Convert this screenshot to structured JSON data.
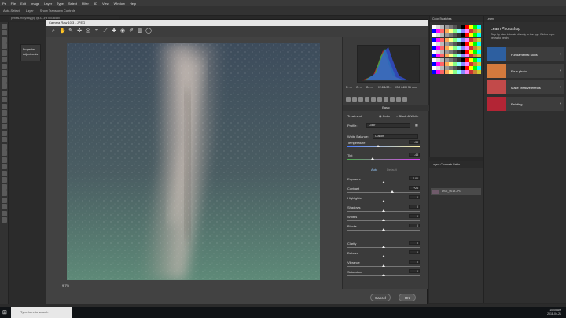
{
  "menubar": [
    "Ps",
    "File",
    "Edit",
    "Image",
    "Layer",
    "Type",
    "Select",
    "Filter",
    "3D",
    "View",
    "Window",
    "Help"
  ],
  "options": [
    "Auto-Select",
    "Layer",
    "Show Transform Controls"
  ],
  "doc_tab": "pexels-milkyway.jpg @ 33.3% (RGB/8#)",
  "dialog": {
    "title": "Camera Raw 10.3 - JPEG",
    "zoom": "9.7%",
    "cancel": "Cancel",
    "ok": "OK"
  },
  "props": {
    "properties": "Properties",
    "adjustments": "Adjustments"
  },
  "rgb": {
    "r": "R: ---",
    "g": "G: ---",
    "b": "B: ---",
    "f": "f/2.8  1/80 s",
    "iso": "ISO 6400  35 mm"
  },
  "panel": {
    "section": "Basic",
    "treatment": "Treatment:",
    "color": "Color",
    "bw": "Black & White",
    "profile": "Profile:",
    "profile_val": "Color",
    "wb": "White Balance:",
    "wb_val": "Custom",
    "auto": "Auto",
    "default": "Default",
    "sliders": [
      {
        "label": "Temperature",
        "value": "-33",
        "pos": 0.42
      },
      {
        "label": "Tint",
        "value": "-43",
        "pos": 0.35
      },
      {
        "label": "Exposure",
        "value": "0.00",
        "pos": 0.5
      },
      {
        "label": "Contrast",
        "value": "+24",
        "pos": 0.62
      },
      {
        "label": "Highlights",
        "value": "0",
        "pos": 0.5
      },
      {
        "label": "Shadows",
        "value": "0",
        "pos": 0.5
      },
      {
        "label": "Whites",
        "value": "0",
        "pos": 0.5
      },
      {
        "label": "Blacks",
        "value": "0",
        "pos": 0.5
      },
      {
        "label": "Clarity",
        "value": "0",
        "pos": 0.5
      },
      {
        "label": "Dehaze",
        "value": "0",
        "pos": 0.5
      },
      {
        "label": "Vibrance",
        "value": "0",
        "pos": 0.5
      },
      {
        "label": "Saturation",
        "value": "0",
        "pos": 0.5
      }
    ]
  },
  "swatches": {
    "tabs": "Color   Swatches"
  },
  "layers": {
    "tabs": "Layers   Channels   Paths",
    "layer": "DSC_0019.JPG"
  },
  "learn": {
    "head": "Learn",
    "title": "Learn Photoshop",
    "sub": "Step-by-step tutorials directly in the app. Pick a topic below to begin.",
    "cards": [
      "Fundamental Skills",
      "Fix a photo",
      "Make creative effects",
      "Painting"
    ]
  },
  "taskbar": {
    "search": "Type here to search",
    "time": "10:05 AM",
    "date": "2018-04-21"
  }
}
